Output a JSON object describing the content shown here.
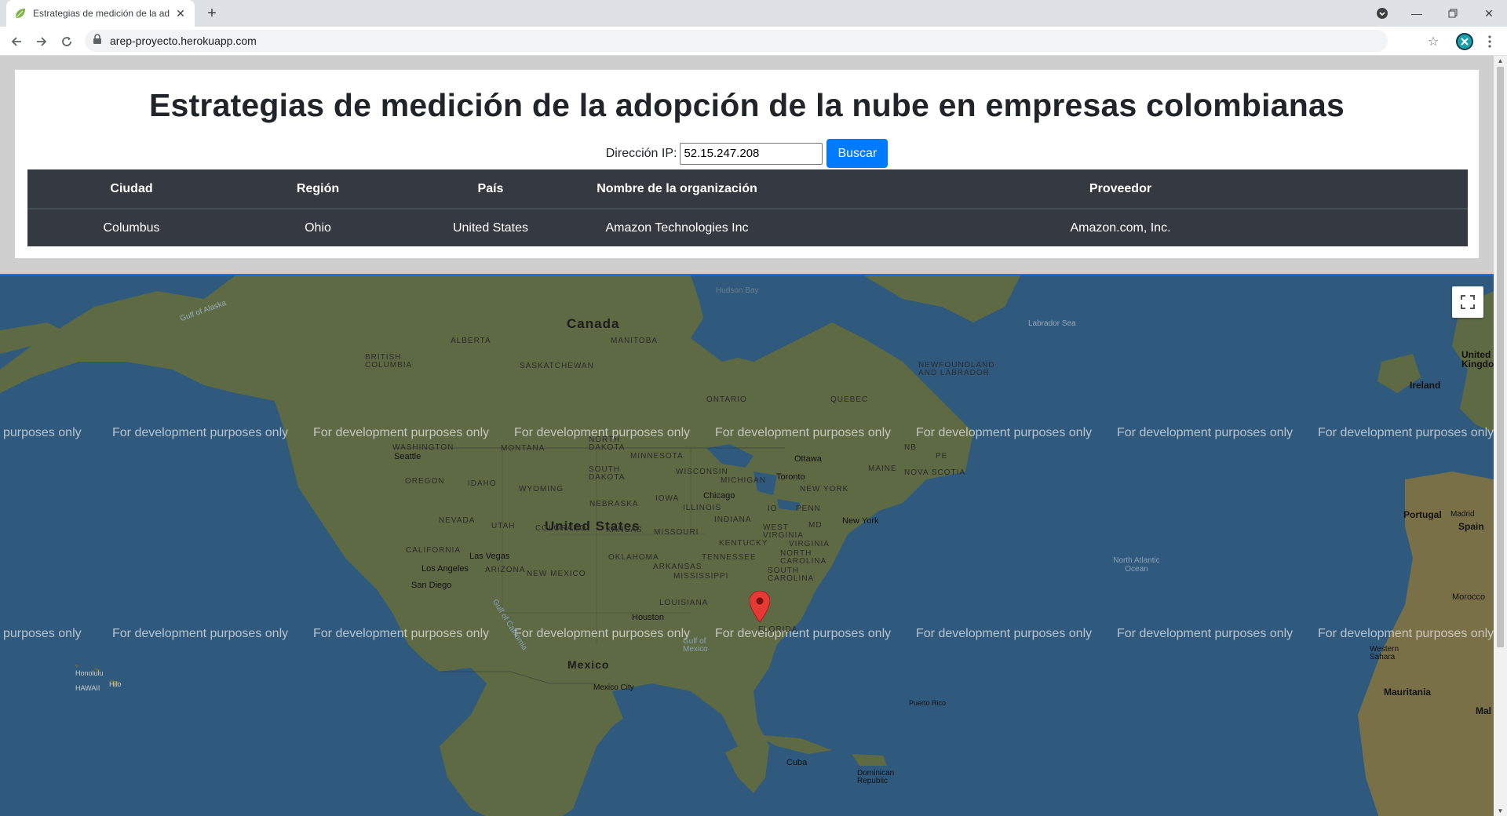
{
  "browser": {
    "tab_title": "Estrategias de medición de la adopción de la nube en empresas colombianas",
    "url": "arep-proyecto.herokuapp.com"
  },
  "page": {
    "title": "Estrategias de medición de la adopción de la nube en empresas colombianas",
    "ip_label": "Dirección IP:",
    "ip_value": "52.15.247.208",
    "search_button": "Buscar"
  },
  "table": {
    "headers": [
      "Ciudad",
      "Región",
      "País",
      "Nombre de la organización",
      "Proveedor"
    ],
    "rows": [
      [
        "Columbus",
        "Ohio",
        "United States",
        "Amazon Technologies Inc",
        "Amazon.com, Inc."
      ]
    ]
  },
  "map": {
    "watermark": "For development purposes only",
    "watermark_cut": "purposes only",
    "countries": {
      "canada": "Canada",
      "united_states": "United States",
      "mexico": "Mexico",
      "cuba": "Cuba",
      "dominican_republic": "Dominican Republic",
      "ireland": "Ireland",
      "united_kingdom": "United Kingdom",
      "portugal": "Portugal",
      "spain": "Spain",
      "western_sahara": "Western Sahara",
      "mauritania": "Mauritania",
      "morocco": "Morocco",
      "mali": "Mal"
    },
    "states": {
      "alberta": "ALBERTA",
      "british_columbia": "BRITISH COLUMBIA",
      "saskatchewan": "SASKATCHEWAN",
      "manitoba": "MANITOBA",
      "ontario": "ONTARIO",
      "quebec": "QUEBEC",
      "newfoundland": "NEWFOUNDLAND AND LABRADOR",
      "washington": "WASHINGTON",
      "montana": "MONTANA",
      "north_dakota": "NORTH DAKOTA",
      "minnesota": "MINNESOTA",
      "oregon": "OREGON",
      "idaho": "IDAHO",
      "wyoming": "WYOMING",
      "south_dakota": "SOUTH DAKOTA",
      "wisconsin": "WISCONSIN",
      "michigan": "MICHIGAN",
      "nebraska": "NEBRASKA",
      "iowa": "IOWA",
      "illinois": "ILLINOIS",
      "indiana": "INDIANA",
      "nevada": "NEVADA",
      "utah": "UTAH",
      "colorado": "COLORADO",
      "kansas": "KANSAS",
      "missouri": "MISSOURI",
      "california": "CALIFORNIA",
      "arizona": "ARIZONA",
      "new_mexico": "NEW MEXICO",
      "oklahoma": "OKLAHOMA",
      "arkansas": "ARKANSAS",
      "tennessee": "TENNESSEE",
      "kentucky": "KENTUCKY",
      "west_virginia": "WEST VIRGINIA",
      "virginia": "VIRGINIA",
      "north_carolina": "NORTH CAROLINA",
      "south_carolina": "SOUTH CAROLINA",
      "mississippi": "MISSISSIPPI",
      "louisiana": "LOUISIANA",
      "florida": "FLORIDA",
      "penn": "PENN",
      "new_york_state": "NEW YORK",
      "maine": "MAINE",
      "nova_scotia": "NOVA SCOTIA",
      "nb": "NB",
      "pe": "PE",
      "md": "MD",
      "ohio_short": "IO"
    },
    "cities": {
      "seattle": "Seattle",
      "ottawa": "Ottawa",
      "toronto": "Toronto",
      "chicago": "Chicago",
      "new_york": "New York",
      "las_vegas": "Las Vegas",
      "los_angeles": "Los Angeles",
      "san_diego": "San Diego",
      "houston": "Houston",
      "mexico_city": "Mexico City",
      "honolulu": "Honolulu",
      "hilo": "Hilo",
      "hawaii": "HAWAII",
      "puerto_rico": "Puerto Rico",
      "madrid": "Madrid"
    },
    "water": {
      "hudson_bay": "Hudson Bay",
      "labrador_sea": "Labrador Sea",
      "gulf_of_alaska": "Gulf of Alaska",
      "north_atlantic": "North Atlantic Ocean",
      "gulf_of_mexico": "Gulf of Mexico",
      "gulf_of_california": "Gulf of California"
    }
  },
  "colors": {
    "table_bg": "#343a40",
    "button_bg": "#007bff",
    "map_water": "#2f5a7e",
    "map_land": "#5f6b45",
    "pin": "#e53935"
  }
}
